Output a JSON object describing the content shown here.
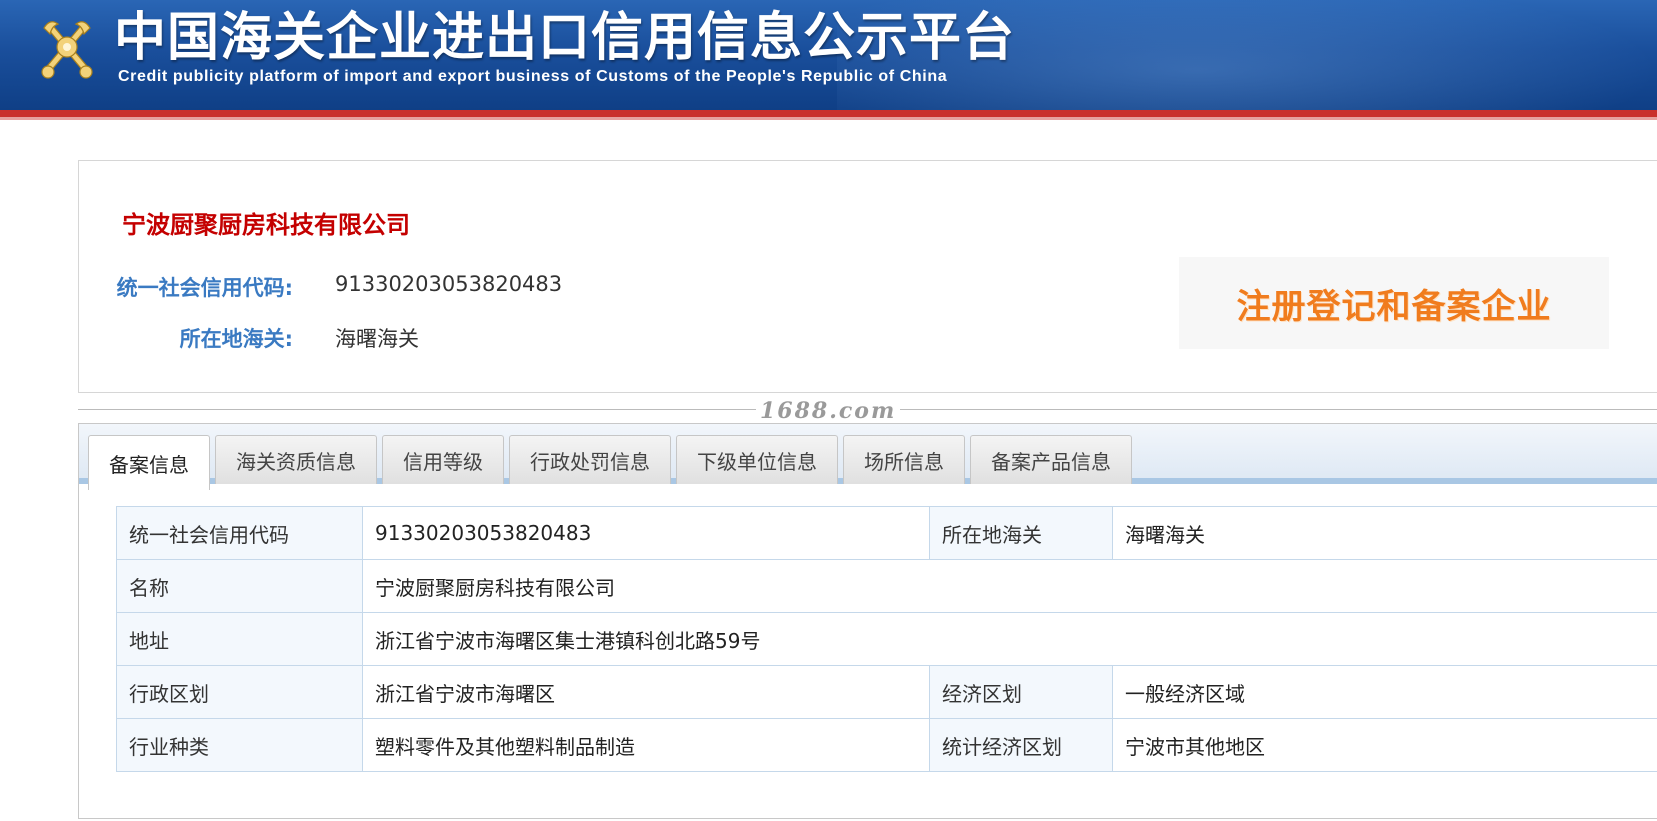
{
  "header": {
    "title": "中国海关企业进出口信用信息公示平台",
    "subtitle": "Credit publicity platform of import and export business of Customs of the People's Republic of China",
    "emblem_icon": "customs-emblem-icon"
  },
  "summary": {
    "company_name": "宁波厨聚厨房科技有限公司",
    "credit_code_label": "统一社会信用代码:",
    "credit_code_value": "91330203053820483",
    "customs_label": "所在地海关:",
    "customs_value": "海曙海关",
    "status_badge": "注册登记和备案企业"
  },
  "watermark": "1688.com",
  "tabs": [
    {
      "label": "备案信息",
      "active": true
    },
    {
      "label": "海关资质信息",
      "active": false
    },
    {
      "label": "信用等级",
      "active": false
    },
    {
      "label": "行政处罚信息",
      "active": false
    },
    {
      "label": "下级单位信息",
      "active": false
    },
    {
      "label": "场所信息",
      "active": false
    },
    {
      "label": "备案产品信息",
      "active": false
    }
  ],
  "details": {
    "rows": [
      {
        "label1": "统一社会信用代码",
        "value1": "91330203053820483",
        "label2": "所在地海关",
        "value2": "海曙海关"
      },
      {
        "label1": "名称",
        "value1": "宁波厨聚厨房科技有限公司"
      },
      {
        "label1": "地址",
        "value1": "浙江省宁波市海曙区集士港镇科创北路59号"
      },
      {
        "label1": "行政区划",
        "value1": "浙江省宁波市海曙区",
        "label2": "经济区划",
        "value2": "一般经济区域"
      },
      {
        "label1": "行业种类",
        "value1": "塑料零件及其他塑料制品制造",
        "label2": "统计经济区划",
        "value2": "宁波市其他地区"
      }
    ]
  },
  "colors": {
    "banner": "#1a4f9c",
    "accent_red": "#c40000",
    "label_blue": "#3a7ac2",
    "status_orange": "#f07c1e"
  }
}
